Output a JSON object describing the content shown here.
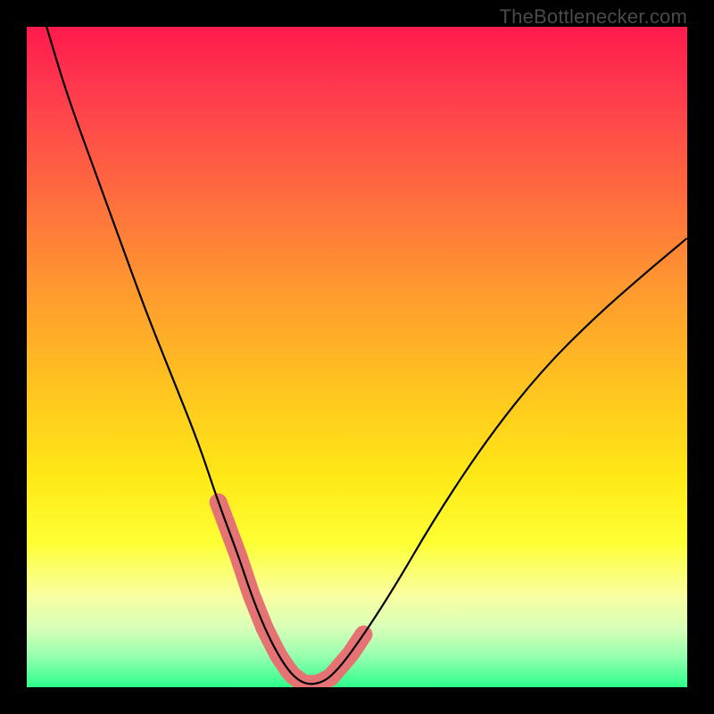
{
  "watermark": "TheBottlenecker.com",
  "chart_data": {
    "type": "line",
    "title": "",
    "xlabel": "",
    "ylabel": "",
    "xlim": [
      0,
      100
    ],
    "ylim": [
      0,
      100
    ],
    "series": [
      {
        "name": "curve",
        "x": [
          3,
          6,
          10,
          14,
          18,
          22,
          26,
          29,
          32,
          34,
          36,
          38,
          40,
          42,
          44,
          46,
          49,
          55,
          62,
          70,
          78,
          86,
          94,
          100
        ],
        "values": [
          100,
          90,
          79,
          68,
          57,
          47,
          37,
          28,
          20,
          14,
          9,
          5,
          2,
          0.5,
          0.5,
          1.5,
          5,
          14,
          26,
          38,
          48,
          56,
          63,
          68
        ]
      }
    ],
    "markers": {
      "thick_segments": [
        {
          "from_x": 29,
          "to_x": 36
        },
        {
          "from_x": 36,
          "to_x": 46
        },
        {
          "from_x": 46,
          "to_x": 51
        }
      ],
      "color": "#e57373",
      "width": 20
    },
    "background": {
      "type": "vertical-gradient",
      "stops": [
        {
          "pos": 0,
          "color": "#ff1a4d"
        },
        {
          "pos": 0.78,
          "color": "#fdff33"
        },
        {
          "pos": 1.0,
          "color": "#2cff8a"
        }
      ]
    }
  }
}
